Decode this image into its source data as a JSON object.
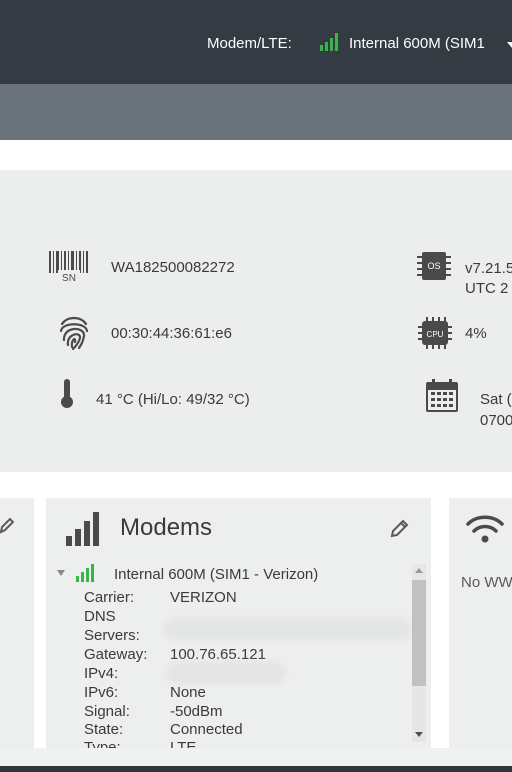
{
  "header": {
    "modem_label": "Modem/LTE:",
    "modem_selected": "Internal 600M (SIM1",
    "signal_color": "#3bb54a"
  },
  "device_info": {
    "serial": "WA182500082272",
    "mac": "00:30:44:36:61:e6",
    "temperature": "41 °C (Hi/Lo: 49/32 °C)",
    "firmware_line1": "v7.21.5",
    "firmware_line2": "UTC 2",
    "cpu": "4%",
    "date_line1": "Sat (",
    "date_line2": "0700"
  },
  "modems_card": {
    "title": "Modems",
    "modem_name": "Internal 600M (SIM1 - Verizon)",
    "rows": [
      {
        "label": "Carrier:",
        "value": "VERIZON"
      },
      {
        "label": "DNS",
        "value": ""
      },
      {
        "label": "Servers:",
        "value": ""
      },
      {
        "label": "Gateway:",
        "value": "100.76.65.121"
      },
      {
        "label": "IPv4:",
        "value": ""
      },
      {
        "label": "IPv6:",
        "value": "None"
      },
      {
        "label": "Signal:",
        "value": "-50dBm"
      },
      {
        "label": "State:",
        "value": "Connected"
      },
      {
        "label": "Type:",
        "value": "LTE"
      }
    ]
  },
  "wifi_card": {
    "status": "No WW"
  },
  "icons": {
    "barcode": "barcode-sn-icon",
    "fingerprint": "fingerprint-icon",
    "thermometer": "thermometer-icon",
    "os": "os-chip-icon",
    "cpu": "cpu-chip-icon",
    "calendar": "calendar-icon",
    "edit": "pencil-icon",
    "signal": "signal-bars-icon",
    "wifi": "wifi-icon"
  }
}
